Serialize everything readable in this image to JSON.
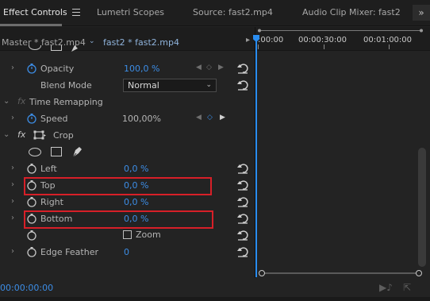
{
  "tabs": [
    {
      "label": "Effect Controls",
      "active": true
    },
    {
      "label": "Lumetri Scopes"
    },
    {
      "label": "Source: fast2.mp4"
    },
    {
      "label": "Audio Clip Mixer: fast2"
    }
  ],
  "more_label": "»",
  "header": {
    "master_label": "Master * fast2.mp4",
    "clip_label": "fast2 * fast2.mp4"
  },
  "properties": {
    "opacity": {
      "label": "Opacity",
      "value": "100,0 %"
    },
    "blend_mode": {
      "label": "Blend Mode",
      "value": "Normal"
    },
    "time_remapping": {
      "label": "Time Remapping"
    },
    "speed": {
      "label": "Speed",
      "value": "100,00%"
    },
    "crop": {
      "label": "Crop",
      "left": {
        "label": "Left",
        "value": "0,0 %"
      },
      "top": {
        "label": "Top",
        "value": "0,0 %"
      },
      "right": {
        "label": "Right",
        "value": "0,0 %"
      },
      "bottom": {
        "label": "Bottom",
        "value": "0,0 %"
      },
      "zoom": {
        "label": "Zoom",
        "checked": false
      },
      "edge_feather": {
        "label": "Edge Feather",
        "value": "0"
      }
    }
  },
  "fx_label": "fx",
  "ruler": {
    "ticks": [
      ":00:00",
      "00:00:30:00",
      "00:01:00:00"
    ]
  },
  "footer": {
    "timecode": "00:00:00:00"
  },
  "colors": {
    "accent_value": "#3c8de6",
    "playhead": "#2a8df0",
    "highlight": "#d71f28"
  }
}
